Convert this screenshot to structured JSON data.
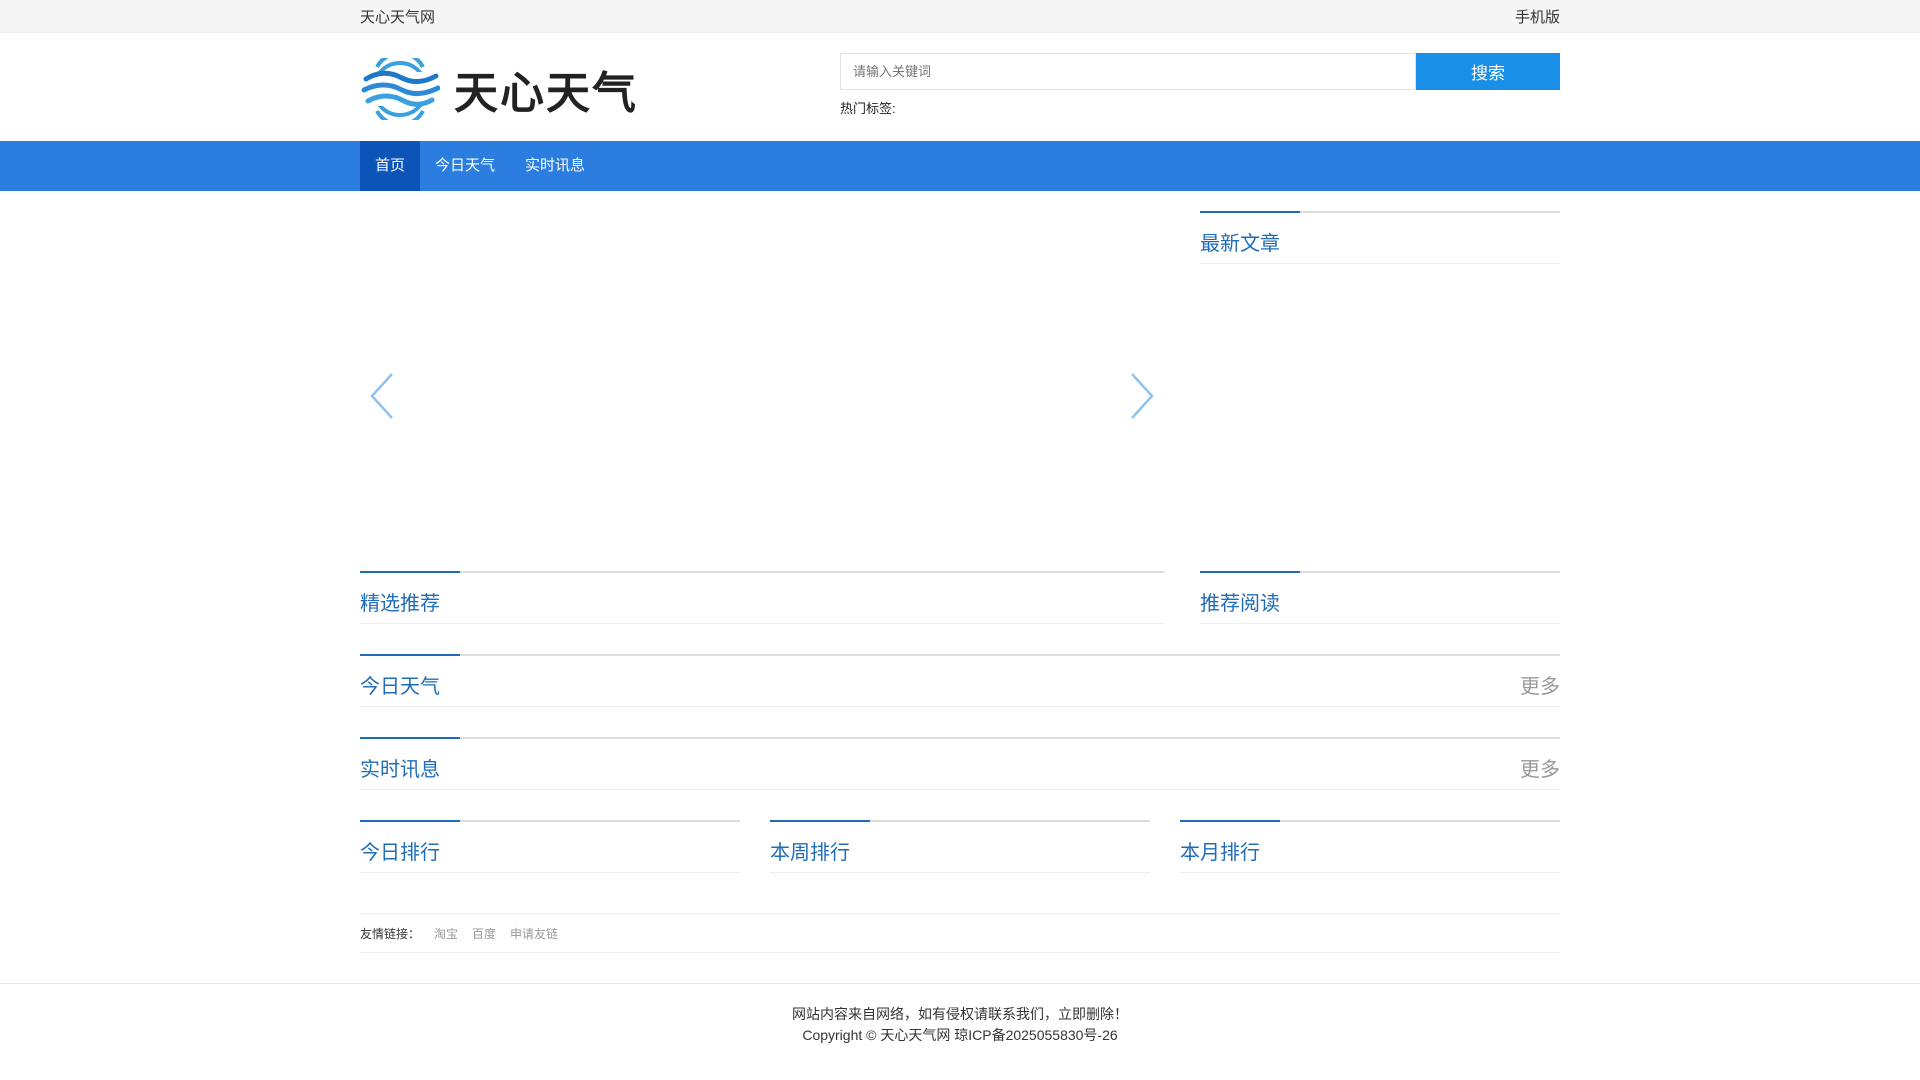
{
  "topbar": {
    "site_name": "天心天气网",
    "mobile": "手机版"
  },
  "header": {
    "logo_text": "天心天气",
    "search_placeholder": "请输入关键词",
    "search_button": "搜索",
    "hot_tags_label": "热门标签:"
  },
  "nav": {
    "items": [
      "首页",
      "今日天气",
      "实时讯息"
    ],
    "active_index": 0
  },
  "sections": {
    "latest": "最新文章",
    "featured": "精选推荐",
    "recommended": "推荐阅读",
    "today_weather": {
      "title": "今日天气",
      "more": "更多"
    },
    "realtime": {
      "title": "实时讯息",
      "more": "更多"
    },
    "rank_day": "今日排行",
    "rank_week": "本周排行",
    "rank_month": "本月排行"
  },
  "friend_links": {
    "label": "友情链接：",
    "links": [
      "淘宝",
      "百度",
      "申请友链"
    ]
  },
  "footer": {
    "notice": "网站内容来自网络，如有侵权请联系我们，立即删除！",
    "copyright": "Copyright © 天心天气网 琼ICP备2025055830号-26"
  },
  "colors": {
    "nav_bg": "#2b7de0",
    "nav_active": "#0d54b8",
    "search_button": "#1a8fe8",
    "title": "#1f6cb8"
  }
}
